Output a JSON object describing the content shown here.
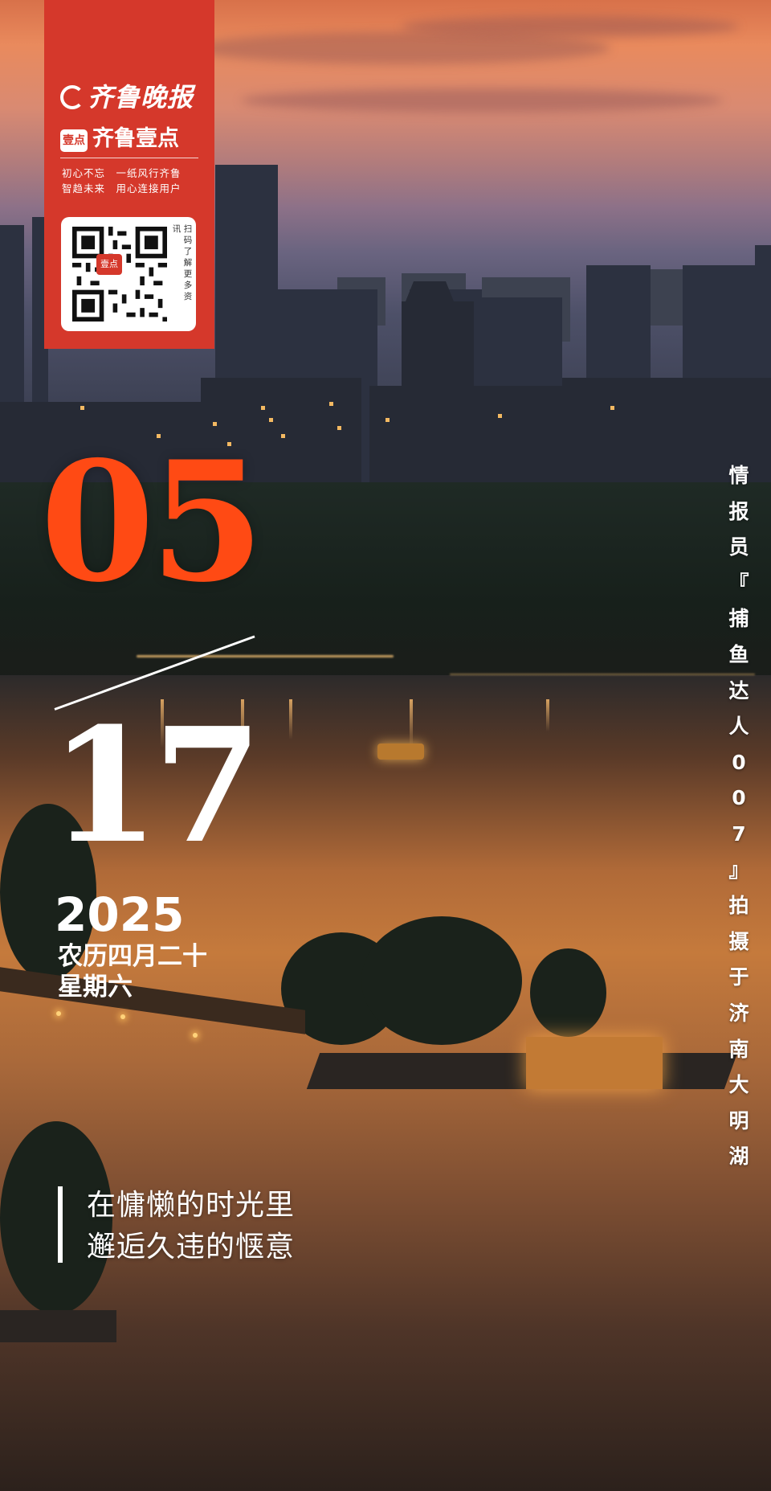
{
  "brand": {
    "newspaper_name": "齐鲁晚报",
    "app_logo_text": "壹点",
    "app_name": "齐鲁壹点",
    "slogan_line1": "初心不忘　一纸风行齐鲁",
    "slogan_line2": "智趋未来　用心连接用户",
    "qr_center_text": "壹点",
    "qr_caption_col1": "扫码了解更多资",
    "qr_caption_col2": "讯",
    "colors": {
      "panel_red": "#d5382b"
    }
  },
  "date": {
    "month": "05",
    "day": "17",
    "year": "2025",
    "lunar_date": "农历四月二十",
    "weekday": "星期六",
    "colors": {
      "month_orange": "#ff4a14",
      "day_white": "#ffffff"
    }
  },
  "photo_credit": {
    "chars": [
      "情",
      "报",
      "员",
      "『",
      "捕",
      "鱼",
      "达",
      "人",
      "0",
      "0",
      "7",
      "』",
      "拍",
      "摄",
      "于",
      "济",
      "南",
      "大",
      "明",
      "湖"
    ]
  },
  "quote": {
    "line1": "在慵懒的时光里",
    "line2": "邂逅久违的惬意"
  }
}
